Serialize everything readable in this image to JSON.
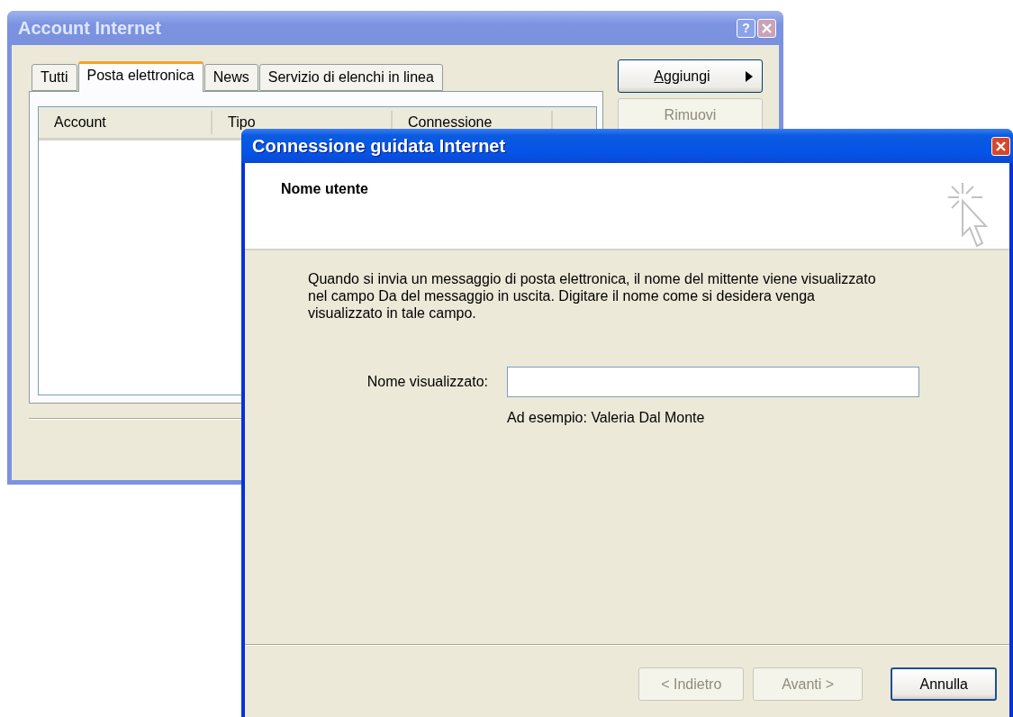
{
  "account_window": {
    "title": "Account Internet",
    "help_button": "?",
    "tabs": [
      {
        "label": "Tutti",
        "selected": false
      },
      {
        "label": "Posta elettronica",
        "selected": true
      },
      {
        "label": "News",
        "selected": false
      },
      {
        "label": "Servizio di elenchi in linea",
        "selected": false
      }
    ],
    "columns": [
      "Account",
      "Tipo",
      "Connessione"
    ],
    "buttons": [
      {
        "label": "Aggiungi",
        "kind": "menu",
        "disabled": false,
        "underline_first": true
      },
      {
        "label": "Rimuovi",
        "kind": "plain",
        "disabled": true,
        "underline_first": false
      }
    ]
  },
  "wizard": {
    "title": "Connessione guidata Internet",
    "header_title": "Nome utente",
    "description": "Quando si invia un messaggio di posta elettronica, il nome del mittente viene visualizzato nel campo Da del messaggio in uscita. Digitare il nome come si desidera venga visualizzato in tale campo.",
    "field": {
      "label": "Nome visualizzato:",
      "hint": "Ad esempio: Valeria Dal Monte"
    },
    "buttons": [
      {
        "label": "< Indietro",
        "disabled": true,
        "default": false
      },
      {
        "label": "Avanti >",
        "disabled": true,
        "default": false
      },
      {
        "label": "Annulla",
        "disabled": false,
        "default": true
      }
    ]
  }
}
